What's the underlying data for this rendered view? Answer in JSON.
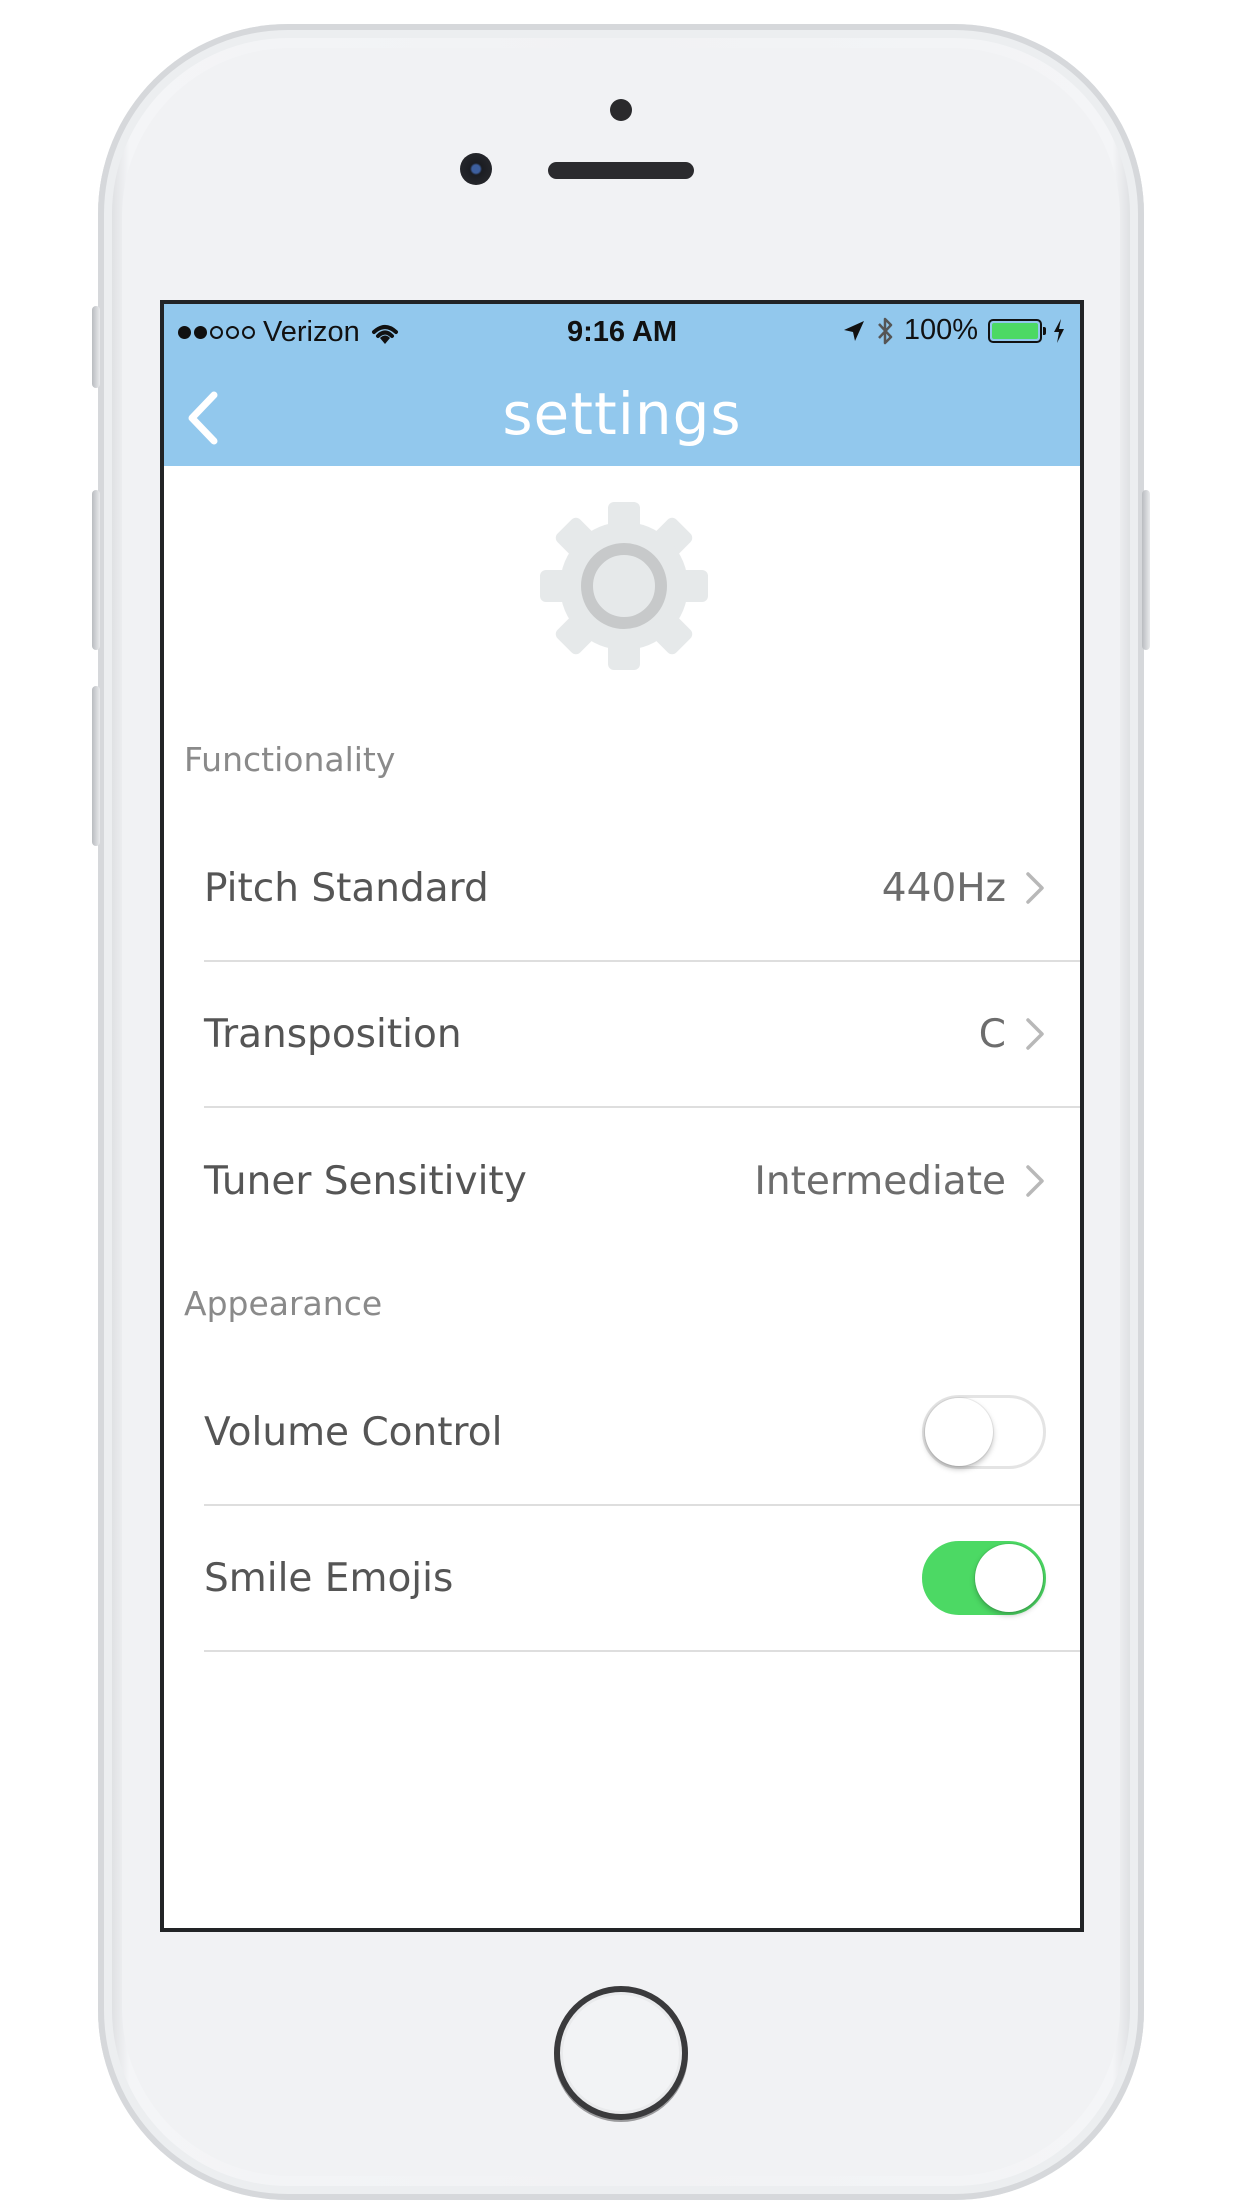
{
  "status_bar": {
    "carrier": "Verizon",
    "time": "9:16 AM",
    "battery_percent": "100%",
    "battery_level": 1.0,
    "signal_bars_filled": 2,
    "signal_bars_total": 5,
    "icons": [
      "wifi-icon",
      "location-arrow-icon",
      "bluetooth-icon",
      "battery-icon",
      "charging-bolt-icon"
    ]
  },
  "navbar": {
    "title": "settings",
    "back_icon": "chevron-left-icon",
    "background_color": "#92c8ed"
  },
  "hero": {
    "icon": "gear-icon"
  },
  "sections": {
    "functionality": {
      "header": "Functionality",
      "rows": [
        {
          "label": "Pitch Standard",
          "value": "440Hz"
        },
        {
          "label": "Transposition",
          "value": "C"
        },
        {
          "label": "Tuner Sensitivity",
          "value": "Intermediate"
        }
      ]
    },
    "appearance": {
      "header": "Appearance",
      "rows": [
        {
          "label": "Volume Control",
          "toggle_on": false
        },
        {
          "label": "Smile Emojis",
          "toggle_on": true
        }
      ]
    }
  },
  "colors": {
    "toggle_on": "#4cd964",
    "header_text": "#8a8a8a",
    "row_text": "#555555"
  }
}
